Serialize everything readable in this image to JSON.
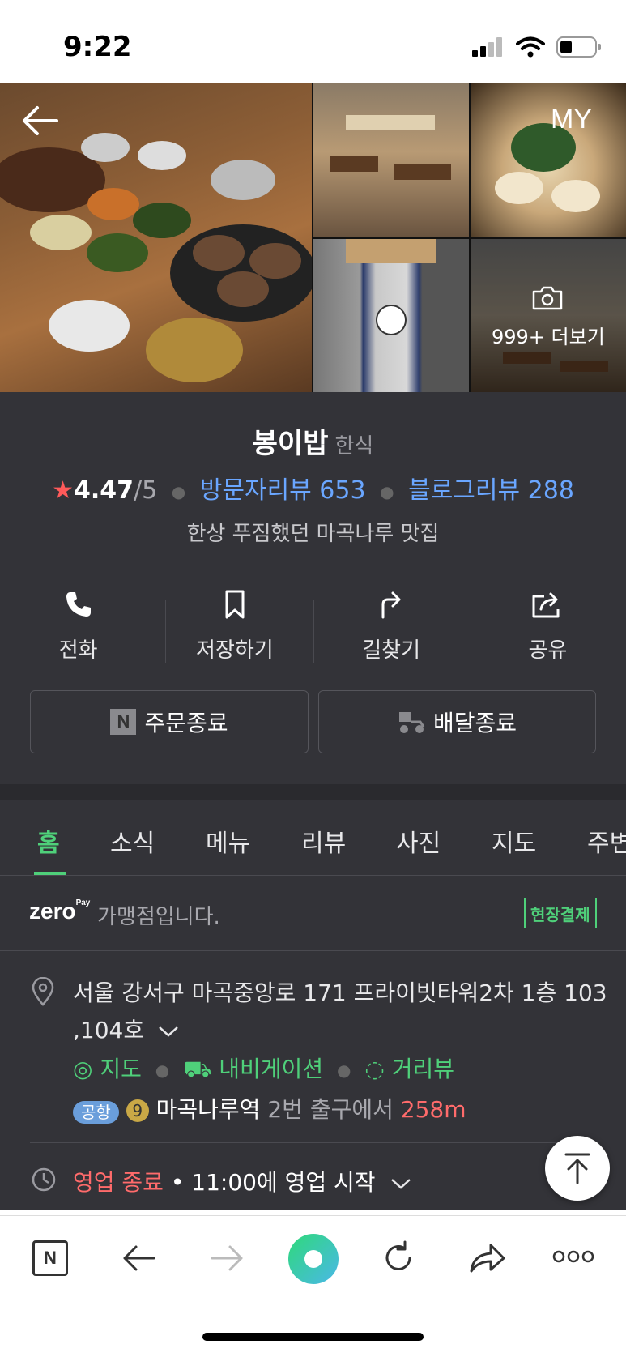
{
  "status_bar": {
    "time": "9:22"
  },
  "gallery": {
    "back_label": "←",
    "my_label": "MY",
    "more_label": "999+ 더보기"
  },
  "place": {
    "name": "봉이밥",
    "category": "한식",
    "rating": "4.47",
    "rating_max": "/5",
    "visitor_reviews": "방문자리뷰 653",
    "blog_reviews": "블로그리뷰 288",
    "description": "한상 푸짐했던 마곡나루 맛집"
  },
  "actions": [
    {
      "label": "전화",
      "icon": "phone-icon"
    },
    {
      "label": "저장하기",
      "icon": "bookmark-icon"
    },
    {
      "label": "길찾기",
      "icon": "directions-icon"
    },
    {
      "label": "공유",
      "icon": "share-icon"
    }
  ],
  "order_buttons": {
    "order": "주문종료",
    "delivery": "배달종료"
  },
  "tabs": [
    "홈",
    "소식",
    "메뉴",
    "리뷰",
    "사진",
    "지도",
    "주변"
  ],
  "zeropay": {
    "logo": "zero",
    "pay": "Pay",
    "text": "가맹점입니다.",
    "badge": "현장결제"
  },
  "address": {
    "line1": "서울 강서구 마곡중앙로 171 프라이빗타워2차 1층 103",
    "line2": ",104호",
    "links": [
      "지도",
      "내비게이션",
      "거리뷰"
    ],
    "airport_badge": "공항",
    "line_number": "9",
    "station": "마곡나루역",
    "exit_text": "2번 출구에서",
    "distance": "258m"
  },
  "hours": {
    "status": "영업 종료",
    "next": "• 11:00에 영업 시작"
  },
  "colors": {
    "accent_green": "#4fd07a",
    "link_blue": "#6aa6ff",
    "alert_red": "#ff6b6b",
    "panel_bg": "#333338"
  }
}
